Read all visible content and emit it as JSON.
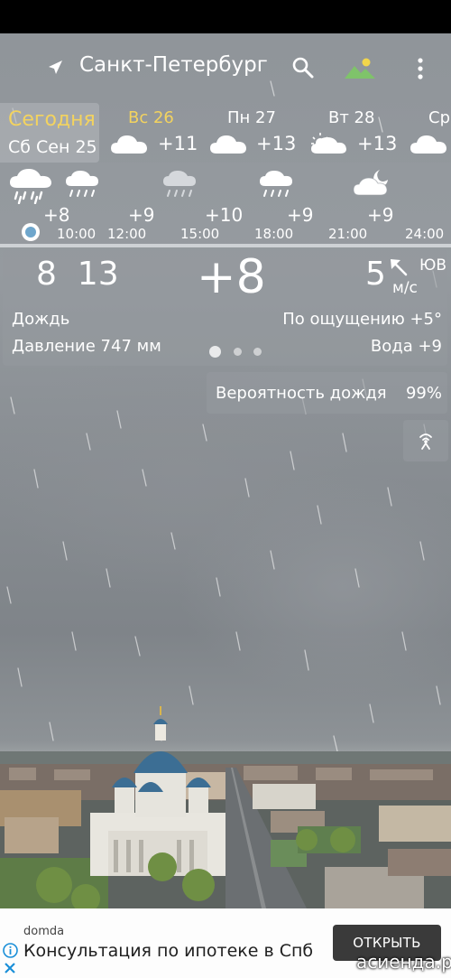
{
  "header": {
    "city": "Санкт-Петербург",
    "icons": [
      "location-arrow-icon",
      "search-icon",
      "background-image-icon",
      "overflow-menu-icon"
    ]
  },
  "days": [
    {
      "name": "Сегодня",
      "date": "Сб Сен 25",
      "selected": true
    },
    {
      "name": "Вс 26",
      "temp": "+11",
      "icon": "cloud-icon",
      "name_color": "#f3d35f"
    },
    {
      "name": "Пн 27",
      "temp": "+13",
      "icon": "cloud-icon"
    },
    {
      "name": "Вт 28",
      "temp": "+13",
      "icon": "partly-sunny-cloud-icon"
    },
    {
      "name": "Ср",
      "icon": "cloud-icon"
    }
  ],
  "hourly": [
    {
      "time": "10:00",
      "temp": "+8",
      "icon": "heavy-rain-icon"
    },
    {
      "time": "12:00",
      "temp": "+9",
      "icon": "rain-icon"
    },
    {
      "time": "15:00",
      "temp": "+10",
      "icon": "light-rain-icon"
    },
    {
      "time": "18:00",
      "temp": "+9",
      "icon": "rain-icon"
    },
    {
      "time": "21:00",
      "temp": "+9",
      "icon": "cloudy-night-icon"
    },
    {
      "time": "24:00",
      "temp": ""
    }
  ],
  "current": {
    "min": "8",
    "max": "13",
    "temp": "+8",
    "wind_speed": "5",
    "wind_dir": "ЮВ",
    "wind_unit": "м/с",
    "condition": "Дождь",
    "feels_like": "По ощущению +5°",
    "pressure": "Давление 747 мм",
    "water": "Вода +9",
    "page_count": 3,
    "active_page": 1
  },
  "rain": {
    "label": "Вероятность дождя",
    "value": "99%"
  },
  "ad": {
    "advertiser": "domda",
    "text": "Консультация по ипотеке в Спб",
    "button": "ОТКРЫТЬ"
  },
  "watermark": "асиенда.ру",
  "colors": {
    "today_accent": "#f3d35f",
    "now_dot": "#6ea6cc",
    "ad_button": "#3a3a3a"
  }
}
